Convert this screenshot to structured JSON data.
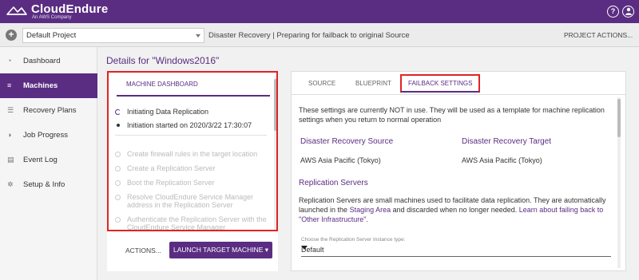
{
  "brand": {
    "name": "CloudEndure",
    "subtitle": "An AWS Company"
  },
  "header": {
    "help_icon": "?",
    "user_icon": "person"
  },
  "project_bar": {
    "add_icon": "+",
    "project_name": "Default Project",
    "purpose": "Disaster Recovery  |  Preparing for failback to original Source",
    "actions_label": "PROJECT ACTIONS..."
  },
  "sidebar": {
    "items": [
      {
        "label": "Dashboard",
        "icon": "dashboard-icon"
      },
      {
        "label": "Machines",
        "icon": "list-icon"
      },
      {
        "label": "Recovery Plans",
        "icon": "plans-icon"
      },
      {
        "label": "Job Progress",
        "icon": "progress-icon"
      },
      {
        "label": "Event Log",
        "icon": "document-icon"
      },
      {
        "label": "Setup & Info",
        "icon": "gear-icon"
      }
    ]
  },
  "main": {
    "title": "Details for \"Windows2016\"",
    "machine_tab": "MACHINE DASHBOARD",
    "steps": [
      {
        "text": "Initiating Data Replication",
        "state": "current"
      },
      {
        "text": "Initiation started on 2020/3/22 17:30:07",
        "state": "dot"
      },
      {
        "text": "Create firewall rules in the target location",
        "state": "pending"
      },
      {
        "text": "Create a Replication Server",
        "state": "pending"
      },
      {
        "text": "Boot the Replication Server",
        "state": "pending"
      },
      {
        "text": "Resolve CloudEndure Service Manager address in the Replication Server",
        "state": "pending"
      },
      {
        "text": "Authenticate the Replication Server with the CloudEndure Service Manager",
        "state": "pending"
      }
    ],
    "actions_label": "ACTIONS...",
    "launch_label": "LAUNCH TARGET MACHINE  ▾",
    "tabs": [
      "SOURCE",
      "BLUEPRINT",
      "FAILBACK SETTINGS"
    ],
    "notice": "These settings are currently NOT in use. They will be used as a template for machine replication settings when you return to normal operation",
    "dr_source_heading": "Disaster Recovery Source",
    "dr_target_heading": "Disaster Recovery Target",
    "dr_source_value": "AWS Asia Pacific (Tokyo)",
    "dr_target_value": "AWS Asia Pacific (Tokyo)",
    "replication_heading": "Replication Servers",
    "replication_desc_1": "Replication Servers are small machines used to facilitate data replication.  They are automatically launched in the ",
    "staging_link": "Staging Area",
    "replication_desc_2": " and discarded when no longer needed.  ",
    "failback_link": "Learn about failing back to \"Other Infrastructure\".",
    "instance_type_label": "Choose the Replication Server Instance type:",
    "instance_type_value": "Default"
  },
  "colors": {
    "brand_purple": "#5a2d82",
    "highlight_red": "#e02424"
  }
}
